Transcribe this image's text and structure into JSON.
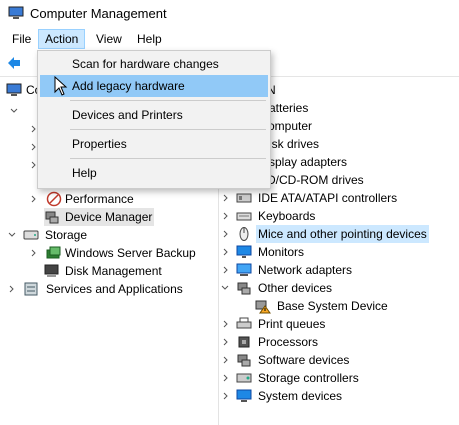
{
  "window": {
    "title": "Computer Management"
  },
  "menubar": {
    "file": "File",
    "action": "Action",
    "view": "View",
    "help": "Help"
  },
  "action_menu": {
    "scan": "Scan for hardware changes",
    "legacy": "Add legacy hardware",
    "devices_printers": "Devices and Printers",
    "properties": "Properties",
    "help": "Help"
  },
  "left_tree": {
    "root_partial": "Co",
    "performance": "Performance",
    "device_manager": "Device Manager",
    "storage": "Storage",
    "wsb": "Windows Server Backup",
    "disk_mgmt": "Disk Management",
    "services_apps": "Services and Applications"
  },
  "right_tree": {
    "header_partial": "N",
    "batteries_partial": "atteries",
    "computer_partial": "omputer",
    "disk_partial": "isk drives",
    "display_partial": "splay adapters",
    "dvd_partial": "VD/CD-ROM drives",
    "ide": "IDE ATA/ATAPI controllers",
    "keyboards": "Keyboards",
    "mice": "Mice and other pointing devices",
    "monitors": "Monitors",
    "network": "Network adapters",
    "other": "Other devices",
    "base_system": "Base System Device",
    "print_queues": "Print queues",
    "processors": "Processors",
    "software": "Software devices",
    "storage_ctrl": "Storage controllers",
    "system": "System devices"
  },
  "colors": {
    "menu_hover": "#91c9f7",
    "selection": "#cce8ff",
    "accent": "#0078d7"
  }
}
